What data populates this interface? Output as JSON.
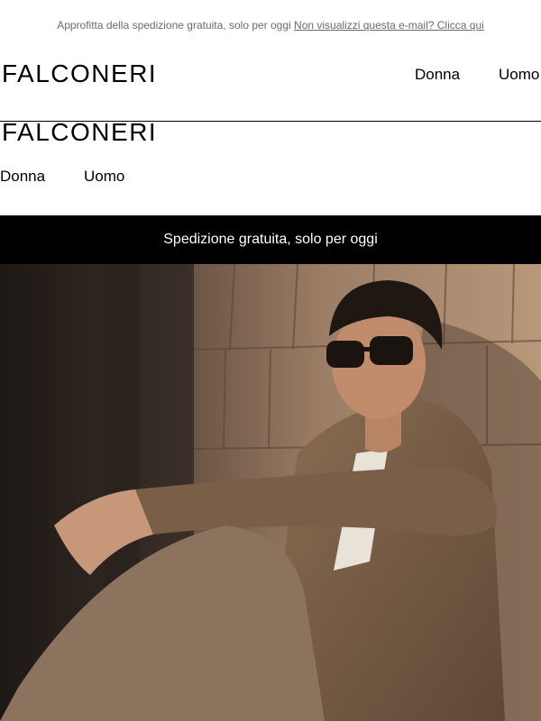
{
  "preheader": {
    "text": "Approfitta della spedizione gratuita, solo per oggi",
    "link_label": "Non visualizzi questa e-mail? Clicca qui"
  },
  "header": {
    "brand": "FALCONERI",
    "nav": [
      {
        "label": "Donna"
      },
      {
        "label": "Uomo"
      }
    ]
  },
  "secondary_header": {
    "brand": "FALCONERI",
    "nav": [
      {
        "label": "Donna"
      },
      {
        "label": "Uomo"
      }
    ]
  },
  "banner": {
    "text": "Spedizione gratuita, solo per oggi",
    "background": "#000000",
    "color": "#ffffff"
  },
  "hero": {
    "image": "man-in-sunglasses-knit-cardigan-against-wood-shingles"
  }
}
